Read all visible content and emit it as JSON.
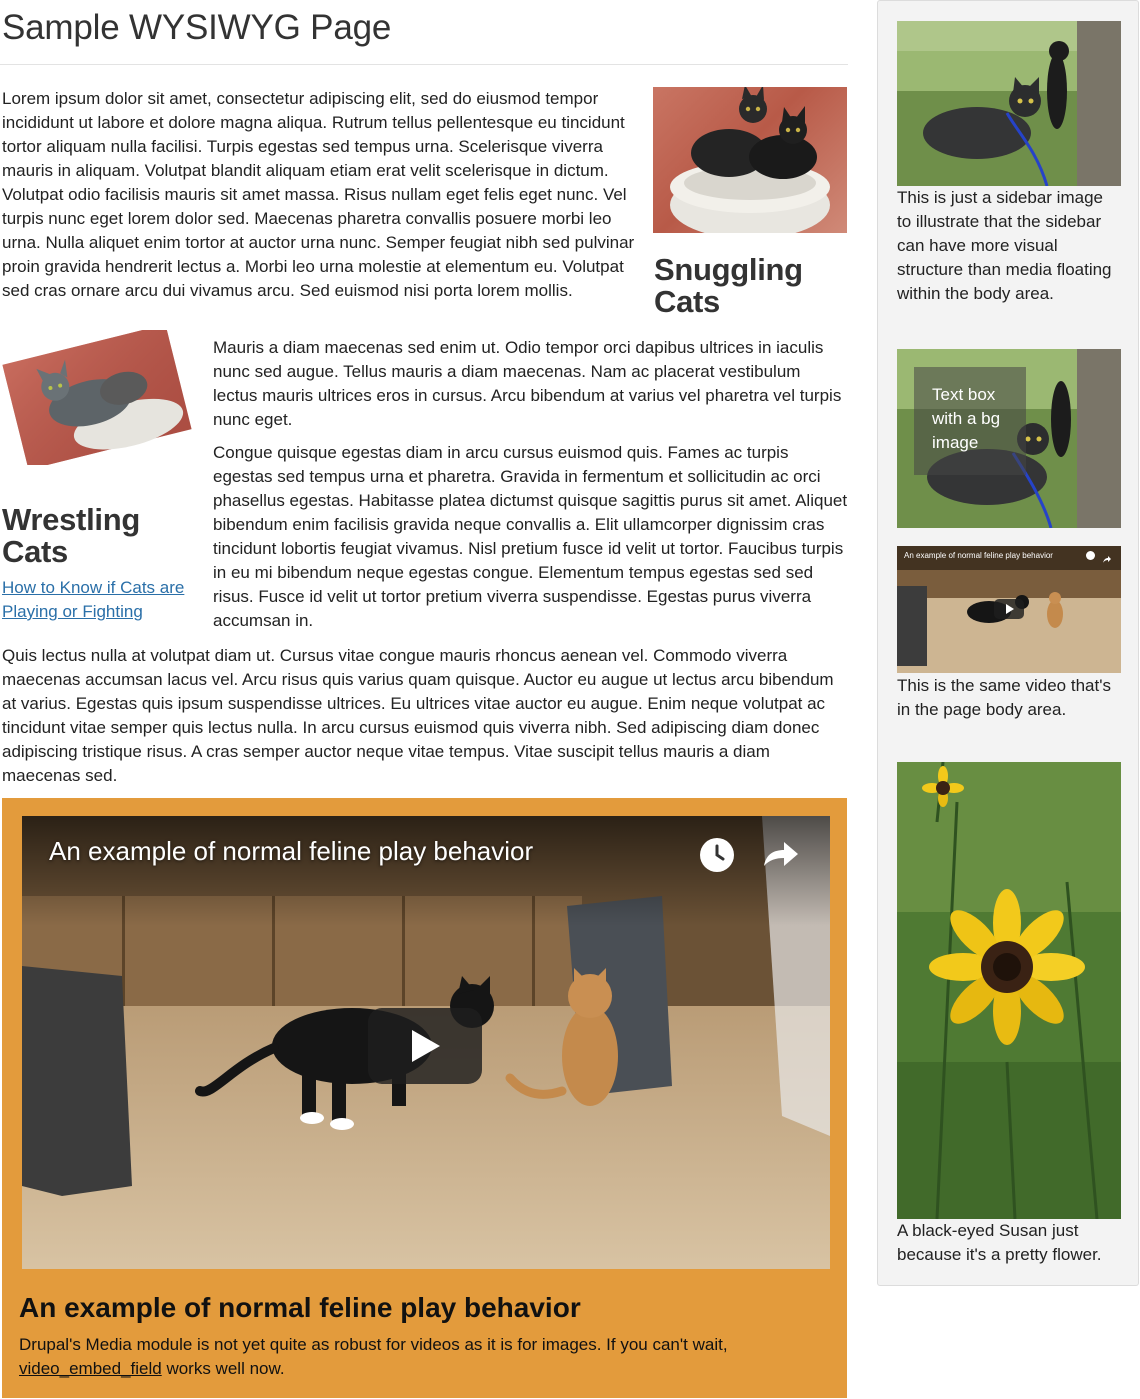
{
  "page": {
    "title": "Sample WYSIWYG Page"
  },
  "body": {
    "paragraphs": [
      "Lorem ipsum dolor sit amet, consectetur adipiscing elit, sed do eiusmod tempor incididunt ut labore et dolore magna aliqua. Rutrum tellus pellentesque eu tincidunt tortor aliquam nulla facilisi. Turpis egestas sed tempus urna. Scelerisque viverra mauris in aliquam. Volutpat blandit aliquam etiam erat velit scelerisque in dictum. Volutpat odio facilisis mauris sit amet massa. Risus nullam eget felis eget nunc. Vel turpis nunc eget lorem dolor sed. Maecenas pharetra convallis posuere morbi leo urna. Nulla aliquet enim tortor at auctor urna nunc. Semper feugiat nibh sed pulvinar proin gravida hendrerit lectus a. Morbi leo urna molestie at elementum eu. Volutpat sed cras ornare arcu dui vivamus arcu. Sed euismod nisi porta lorem mollis.",
      "Mauris a diam maecenas sed enim ut. Odio tempor orci dapibus ultrices in iaculis nunc sed augue. Tellus mauris a diam maecenas. Nam ac placerat vestibulum lectus mauris ultrices eros in cursus. Arcu bibendum at varius vel pharetra vel turpis nunc eget.",
      "Congue quisque egestas diam in arcu cursus euismod quis. Fames ac turpis egestas sed tempus urna et pharetra. Gravida in fermentum et sollicitudin ac orci phasellus egestas. Habitasse platea dictumst quisque sagittis purus sit amet. Aliquet bibendum enim facilisis gravida neque convallis a. Elit ullamcorper dignissim cras tincidunt lobortis feugiat vivamus. Nisl pretium fusce id velit ut tortor. Faucibus turpis in eu mi bibendum neque egestas congue. Elementum tempus egestas sed sed risus. Fusce id velit ut tortor pretium viverra suspendisse. Egestas purus viverra accumsan in.",
      "Quis lectus nulla at volutpat diam ut. Cursus vitae congue mauris rhoncus aenean vel. Commodo viverra maecenas accumsan lacus vel. Arcu risus quis varius quam quisque. Auctor eu augue ut lectus arcu bibendum at varius. Egestas quis ipsum suspendisse ultrices. Eu ultrices vitae auctor eu augue. Enim neque volutpat ac tincidunt vitae semper quis lectus nulla. In arcu cursus euismod quis viverra nibh. Sed adipiscing diam donec adipiscing tristique risus. A cras semper auctor neque vitae tempus. Vitae suscipit tellus mauris a diam maecenas sed."
    ],
    "snuggling": {
      "heading": "Snuggling Cats"
    },
    "wrestling": {
      "heading": "Wrestling Cats",
      "link": "How to Know if Cats are Playing or Fighting"
    },
    "video_card": {
      "video_title": "An example of normal feline play behavior",
      "heading": "An example of normal feline play behavior",
      "description_before": "Drupal's Media module is not yet quite as robust for videos as it is for images. If you can't wait, ",
      "description_link": "video_embed_field",
      "description_after": " works well now.",
      "background_color": "#e39b3c"
    }
  },
  "sidebar": {
    "image_caption": "This is just a sidebar image to illustrate that the sidebar can have more visual structure than media floating within the body area.",
    "textbox_lines": [
      "Text box",
      "with a bg",
      "image"
    ],
    "video_title": "An example of normal feline play behavior",
    "video_caption": "This is the same video that's in the page body area.",
    "flower_caption": "A black-eyed Susan just because it's a pretty flower."
  },
  "icons": {
    "clock": "clock-icon",
    "share": "share-icon",
    "play": "play-icon"
  }
}
